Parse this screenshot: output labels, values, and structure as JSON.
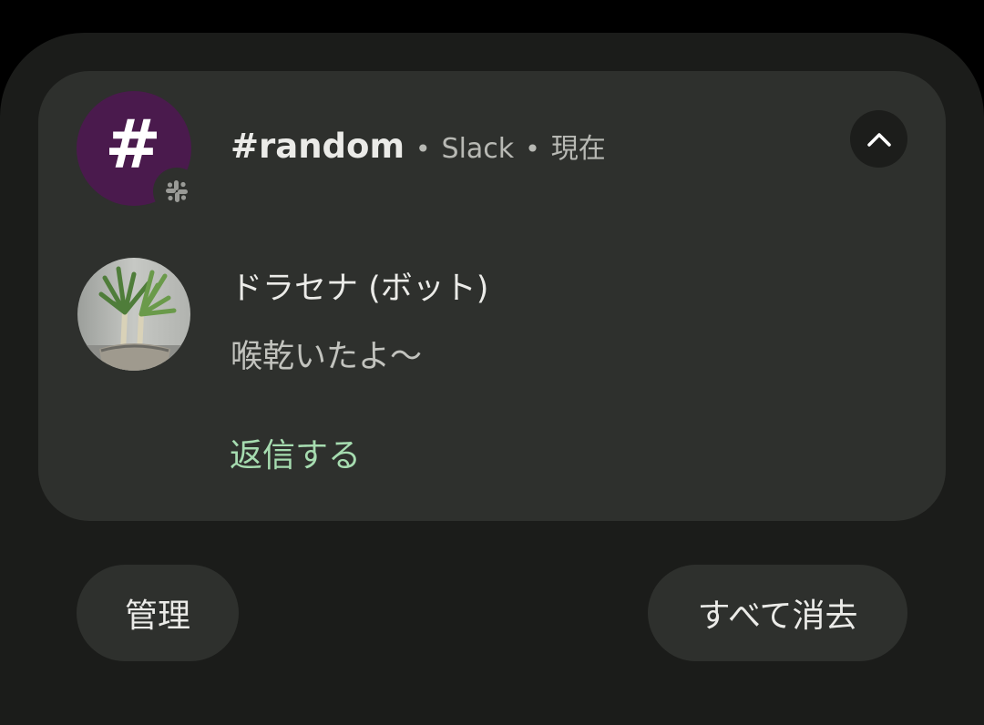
{
  "notification": {
    "app_avatar_symbol": "#",
    "app_avatar_color": "#4a1a4d",
    "app_badge_icon": "slack-icon",
    "channel": "#random",
    "separator": "•",
    "app_name": "Slack",
    "time": "現在",
    "collapse_icon": "chevron-up-icon",
    "sender_avatar": "plant-photo",
    "sender_name": "ドラセナ (ボット)",
    "message": "喉乾いたよ〜",
    "reply_label": "返信する",
    "reply_color": "#a6dcb0"
  },
  "footer": {
    "manage_label": "管理",
    "clear_all_label": "すべて消去"
  }
}
